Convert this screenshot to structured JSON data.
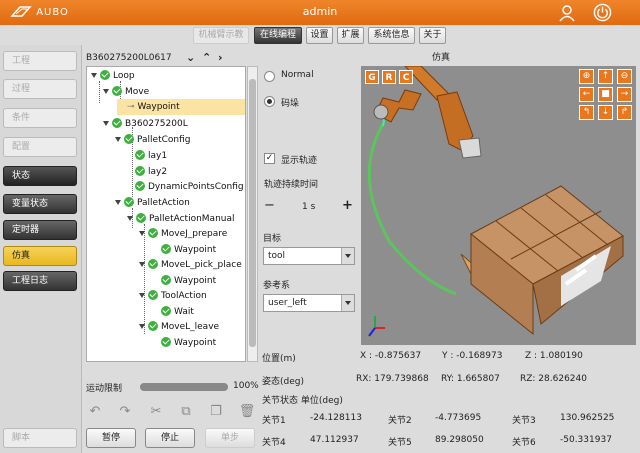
{
  "app": {
    "logo_text": "AUBO",
    "user_name": "admin"
  },
  "tabs": [
    {
      "label": "机械臂示教",
      "state": "disabled"
    },
    {
      "label": "在线编程",
      "state": "active"
    },
    {
      "label": "设置",
      "state": "normal"
    },
    {
      "label": "扩展",
      "state": "normal"
    },
    {
      "label": "系统信息",
      "state": "normal"
    },
    {
      "label": "关于",
      "state": "normal"
    }
  ],
  "sidebar": {
    "items": [
      "工程",
      "过程",
      "条件",
      "配置",
      "状态",
      "变量状态",
      "定时器",
      "仿真",
      "工程日志"
    ],
    "script_label": "脚本"
  },
  "tree": {
    "program_name": "B360275200L0617",
    "nodes": [
      {
        "label": "Loop"
      },
      {
        "label": "Move"
      },
      {
        "label": "Waypoint"
      },
      {
        "label": "B360275200L"
      },
      {
        "label": "PalletConfig"
      },
      {
        "label": "lay1"
      },
      {
        "label": "lay2"
      },
      {
        "label": "DynamicPointsConfig"
      },
      {
        "label": "PalletAction"
      },
      {
        "label": "PalletActionManual"
      },
      {
        "label": "MoveJ_prepare"
      },
      {
        "label": "Waypoint"
      },
      {
        "label": "MoveL_pick_place"
      },
      {
        "label": "Waypoint"
      },
      {
        "label": "ToolAction"
      },
      {
        "label": "Wait"
      },
      {
        "label": "MoveL_leave"
      },
      {
        "label": "Waypoint"
      }
    ]
  },
  "speed": {
    "label": "运动限制",
    "value": 100,
    "display": "100%"
  },
  "buttons": {
    "pause": "暂停",
    "stop": "停止",
    "step": "单步"
  },
  "display": {
    "mode_normal": "Normal",
    "mode_pallet": "码垛",
    "show_trace": "显示轨迹",
    "trace_duration_label": "轨迹持续时间",
    "trace_duration_value": "1 s",
    "minus": "−",
    "plus": "+",
    "target_label": "目标",
    "target_value": "tool",
    "ref_label": "参考系",
    "ref_value": "user_left"
  },
  "view": {
    "title": "仿真",
    "g": "G",
    "r": "R",
    "c": "C"
  },
  "pose": {
    "position_label": "位置(m)",
    "x": "X : -0.875637",
    "y": "Y : -0.168973",
    "z": "Z : 1.080190",
    "attitude_label": "姿态(deg)",
    "rx": "RX: 179.739868",
    "ry": "RY: 1.665807",
    "rz": "RZ: 28.626240",
    "joint_state_label": "关节状态 单位(deg)"
  },
  "joints": [
    {
      "label": "关节1",
      "value": "-24.128113"
    },
    {
      "label": "关节2",
      "value": "-4.773695"
    },
    {
      "label": "关节3",
      "value": "130.962525"
    },
    {
      "label": "关节4",
      "value": "47.112937"
    },
    {
      "label": "关节5",
      "value": "89.298050"
    },
    {
      "label": "关节6",
      "value": "-50.331937"
    }
  ],
  "colors": {
    "brand": "#e8771d",
    "check": "#3db03d",
    "selection": "#fbe3a3"
  }
}
